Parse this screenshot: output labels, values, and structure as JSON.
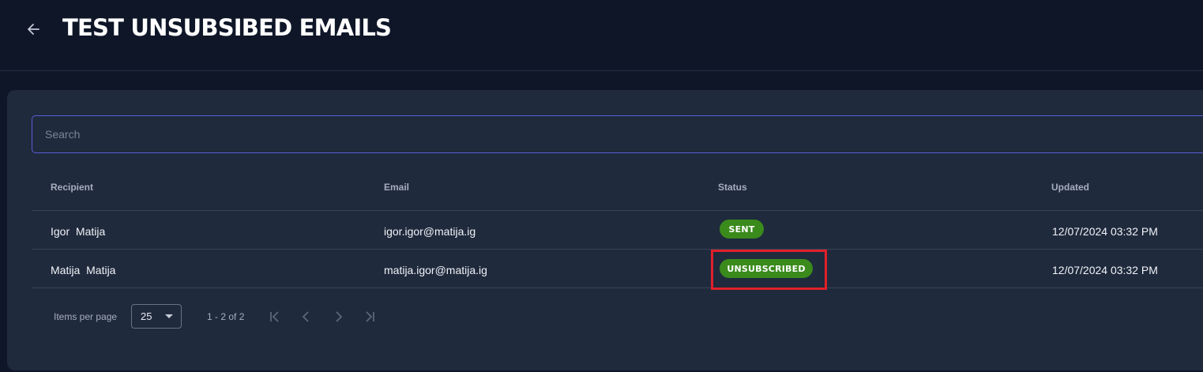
{
  "header": {
    "title": "TEST UNSUBSIBED EMAILS",
    "back_icon": "arrow-left-icon"
  },
  "search": {
    "placeholder": "Search"
  },
  "table": {
    "columns": [
      "Recipient",
      "Email",
      "Status",
      "Updated"
    ],
    "rows": [
      {
        "recipient": "Igor  Matija",
        "email": "igor.igor@matija.ig",
        "status": "SENT",
        "updated": "12/07/2024 03:32 PM"
      },
      {
        "recipient": "Matija  Matija",
        "email": "matija.igor@matija.ig",
        "status": "UNSUBSCRIBED",
        "updated": "12/07/2024 03:32 PM"
      }
    ]
  },
  "pagination": {
    "items_per_page_label": "Items per page",
    "page_size": "25",
    "range": "1 - 2 of 2"
  },
  "colors": {
    "accent": "#5a5cd6",
    "status_green": "#3a8a1c",
    "highlight": "#e0202a"
  }
}
